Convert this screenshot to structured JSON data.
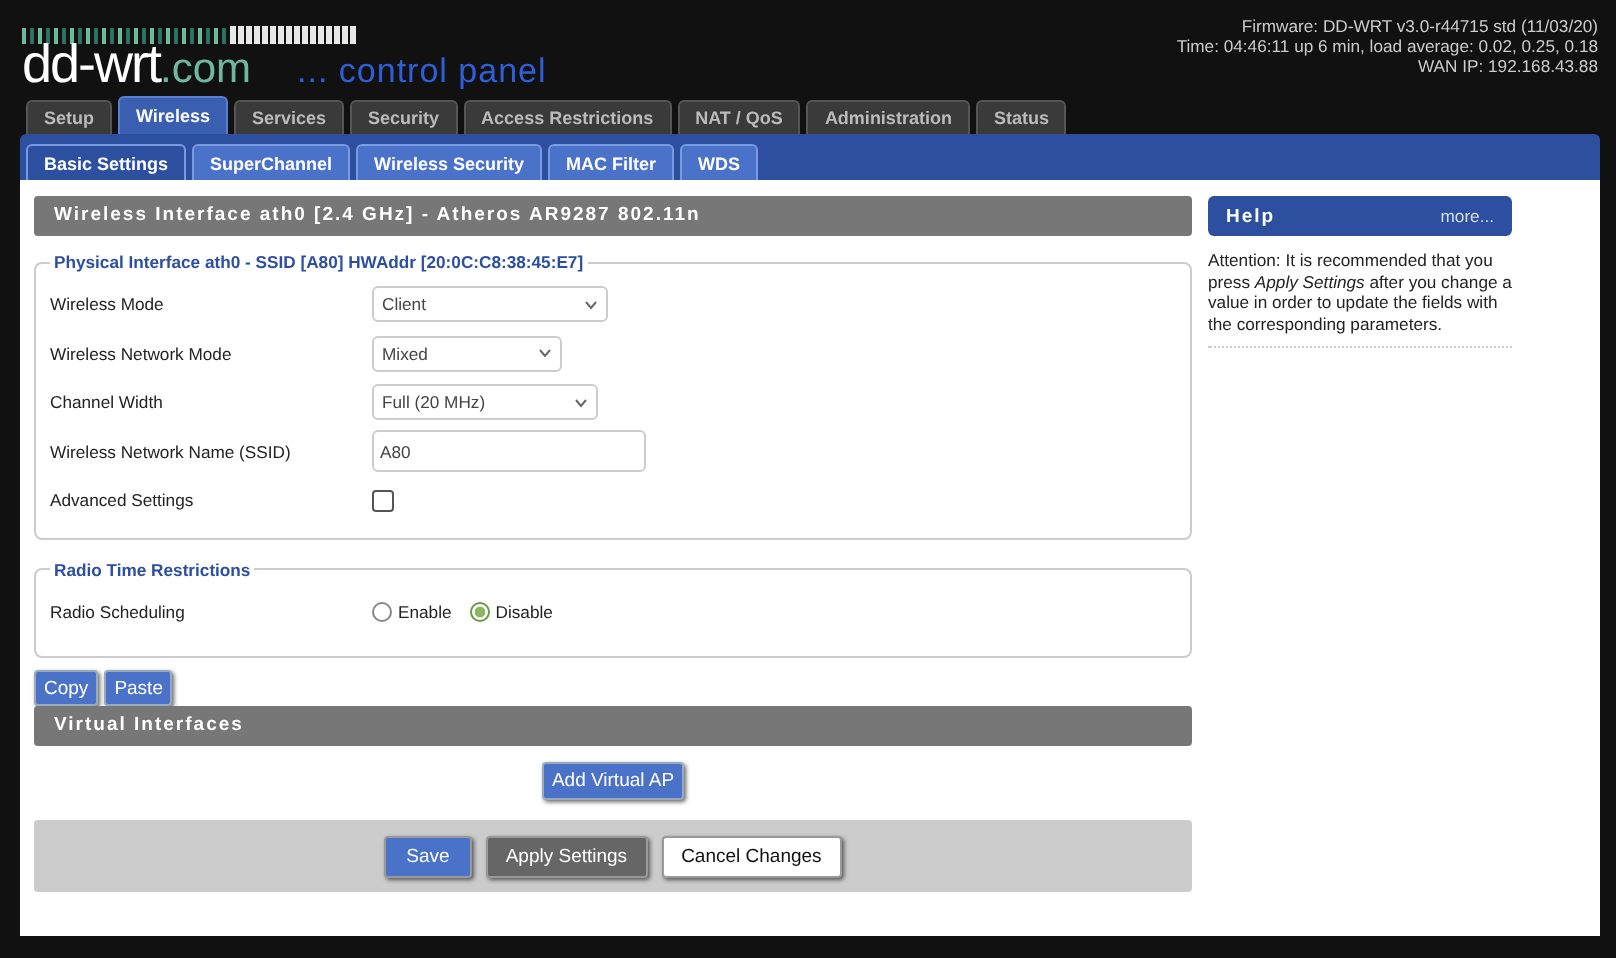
{
  "logo": {
    "name": "dd-wrt",
    "suffix": ".com",
    "tagline": "... control panel"
  },
  "router_info": [
    "Firmware: DD-WRT v3.0-r44715 std (11/03/20)",
    "Time: 04:46:11 up 6 min, load average: 0.02, 0.25, 0.18",
    "WAN IP: 192.168.43.88"
  ],
  "main_tabs": [
    {
      "label": "Setup",
      "selected": false
    },
    {
      "label": "Wireless",
      "selected": true
    },
    {
      "label": "Services",
      "selected": false
    },
    {
      "label": "Security",
      "selected": false
    },
    {
      "label": "Access Restrictions",
      "selected": false
    },
    {
      "label": "NAT / QoS",
      "selected": false
    },
    {
      "label": "Administration",
      "selected": false
    },
    {
      "label": "Status",
      "selected": false
    }
  ],
  "sub_tabs": [
    {
      "label": "Basic Settings",
      "selected": true
    },
    {
      "label": "SuperChannel",
      "selected": false
    },
    {
      "label": "Wireless Security",
      "selected": false
    },
    {
      "label": "MAC Filter",
      "selected": false
    },
    {
      "label": "WDS",
      "selected": false
    }
  ],
  "section_title": "Wireless Interface ath0 [2.4 GHz] - Atheros AR9287 802.11n",
  "physical_interface": {
    "legend": "Physical Interface ath0 - SSID [A80] HWAddr [20:0C:C8:38:45:E7]",
    "rows": [
      {
        "kind": "select",
        "label": "Wireless Mode",
        "value": "Client"
      },
      {
        "kind": "select",
        "label": "Wireless Network Mode",
        "value": "Mixed"
      },
      {
        "kind": "select",
        "label": "Channel Width",
        "value": "Full (20 MHz)"
      },
      {
        "kind": "text",
        "label": "Wireless Network Name (SSID)",
        "value": "A80"
      },
      {
        "kind": "checkbox",
        "label": "Advanced Settings",
        "checked": false
      }
    ]
  },
  "radio_time_restrictions": {
    "legend": "Radio Time Restrictions",
    "label": "Radio Scheduling",
    "options": [
      {
        "label": "Enable",
        "selected": false
      },
      {
        "label": "Disable",
        "selected": true
      }
    ]
  },
  "copy_paste_buttons": [
    "Copy",
    "Paste"
  ],
  "virtual_interfaces": {
    "title": "Virtual Interfaces",
    "button": "Add Virtual AP"
  },
  "actions": [
    {
      "label": "Save",
      "kind": "primary"
    },
    {
      "label": "Apply Settings",
      "kind": "dark"
    },
    {
      "label": "Cancel Changes",
      "kind": "plain"
    }
  ],
  "help": {
    "title": "Help",
    "more": "more...",
    "text": "Attention: It is recommended that you press *Apply Settings* after you change a value in order to update the fields with the corresponding parameters."
  }
}
